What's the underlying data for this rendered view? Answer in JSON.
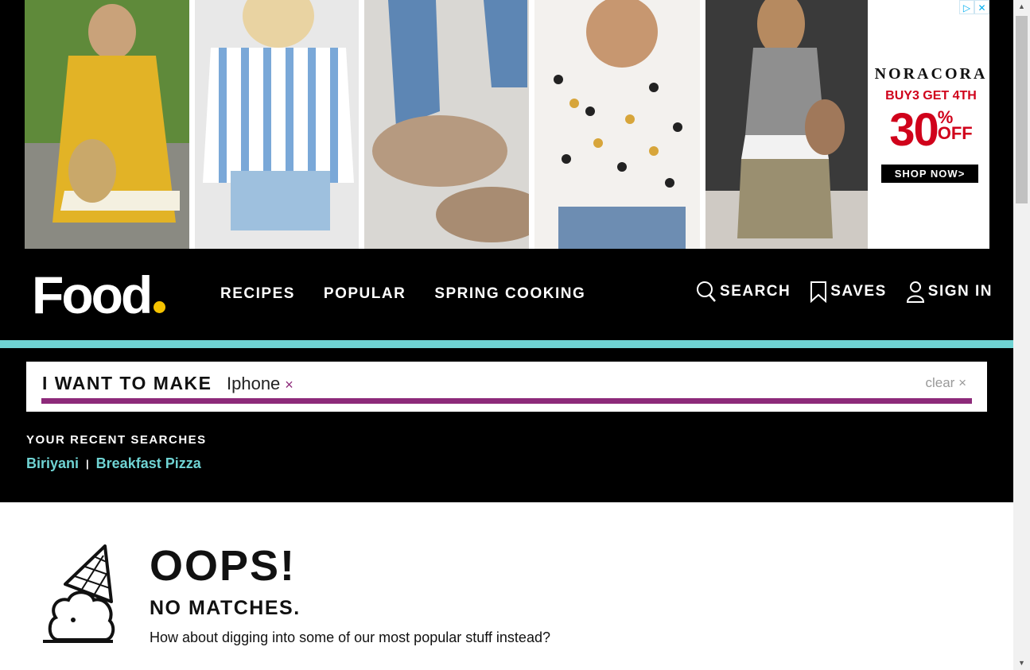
{
  "ad": {
    "badges": [
      "▷",
      "✕"
    ],
    "brand": "NORACORA",
    "deal": "BUY3 GET 4TH",
    "percent": "30",
    "percent_symbol": "%",
    "percent_word": "OFF",
    "cta": "SHOP NOW>"
  },
  "header": {
    "logo": "Food",
    "nav": [
      "RECIPES",
      "POPULAR",
      "SPRING COOKING"
    ],
    "search_label": "SEARCH",
    "saves_label": "SAVES",
    "signin_label": "SIGN IN"
  },
  "search": {
    "label": "I WANT TO MAKE",
    "chip": "Iphone",
    "chip_remove": "×",
    "clear": "clear ×"
  },
  "recent": {
    "title": "YOUR RECENT SEARCHES",
    "links": [
      "Biriyani",
      "Breakfast Pizza"
    ],
    "separator": "|"
  },
  "results": {
    "title": "OOPS!",
    "subtitle": "NO MATCHES.",
    "text": "How about digging into some of our most popular stuff instead?"
  },
  "colors": {
    "accent_teal": "#6fd3d3",
    "accent_purple": "#8d2a7a",
    "logo_dot": "#f5c200"
  }
}
